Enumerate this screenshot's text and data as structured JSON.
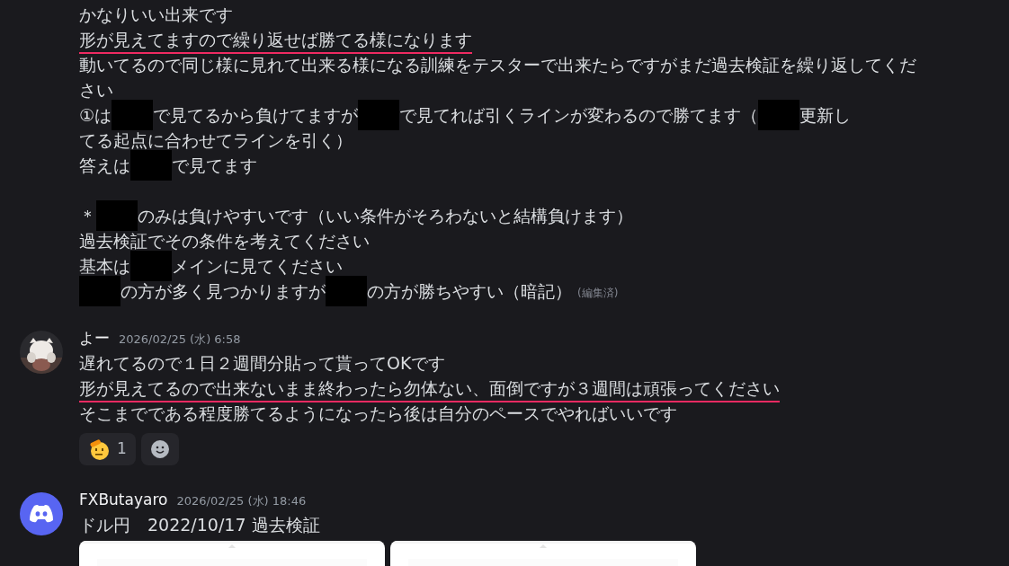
{
  "messages": [
    {
      "kind": "continuation",
      "paragraphs": [
        [
          [
            {
              "text": "かなりいい出来です"
            }
          ],
          [
            {
              "text": "形が見えてますので繰り返せば勝てる様になります",
              "underline": true
            }
          ],
          [
            {
              "text": "動いてるので同じ様に見れて出来る様になる訓練をテスターで出来たらですがまだ過去検証を繰り返してくだ"
            }
          ],
          [
            {
              "text": "さい"
            }
          ],
          [
            {
              "text": "①は"
            },
            {
              "kind": "redaction"
            },
            {
              "text": "で見てるから負けてますが"
            },
            {
              "kind": "redaction"
            },
            {
              "text": "で見てれば引くラインが変わるので勝てます（"
            },
            {
              "kind": "redaction"
            },
            {
              "text": "更新し"
            }
          ],
          [
            {
              "text": "てる起点に合わせてラインを引く）"
            }
          ],
          [
            {
              "text": "答えは"
            },
            {
              "kind": "redaction"
            },
            {
              "text": "で見てます"
            }
          ]
        ],
        [
          [
            {
              "text": "＊"
            },
            {
              "kind": "redaction"
            },
            {
              "text": "のみは負けやすいです（いい条件がそろわないと結構負けます）"
            }
          ],
          [
            {
              "text": "過去検証でその条件を考えてください"
            }
          ],
          [
            {
              "text": "基本は"
            },
            {
              "kind": "redaction"
            },
            {
              "text": "メインに見てください"
            }
          ],
          [
            {
              "kind": "redaction"
            },
            {
              "text": "の方が多く見つかりますが"
            },
            {
              "kind": "redaction"
            },
            {
              "text": "の方が勝ちやすい（暗記）"
            },
            {
              "kind": "edited",
              "text": "(編集済)"
            }
          ]
        ]
      ]
    },
    {
      "kind": "member",
      "author": "よー",
      "time": "2026/02/25 (水) 6:58",
      "paragraphs": [
        [
          [
            {
              "text": "遅れてるので１日２週間分貼って貰ってOKです"
            }
          ],
          [
            {
              "text": "形が見えてるので出来ないまま終わったら勿体ない、面倒ですが３週間は頑張ってください",
              "underline": true
            }
          ],
          [
            {
              "text": "そこまでである程度勝てるようになったら後は自分のペースでやればいいです"
            }
          ]
        ]
      ],
      "reactions": [
        {
          "kind": "salute",
          "count": "1"
        },
        {
          "kind": "add"
        }
      ]
    },
    {
      "kind": "app",
      "author": "FXButayaro",
      "time": "2026/02/25 (水) 18:46",
      "paragraphs": [
        [
          [
            {
              "text": "ドル円　2022/10/17 過去検証"
            }
          ]
        ]
      ],
      "attachments": [
        {
          "kind": "picture"
        },
        {
          "kind": "picture"
        }
      ]
    }
  ]
}
